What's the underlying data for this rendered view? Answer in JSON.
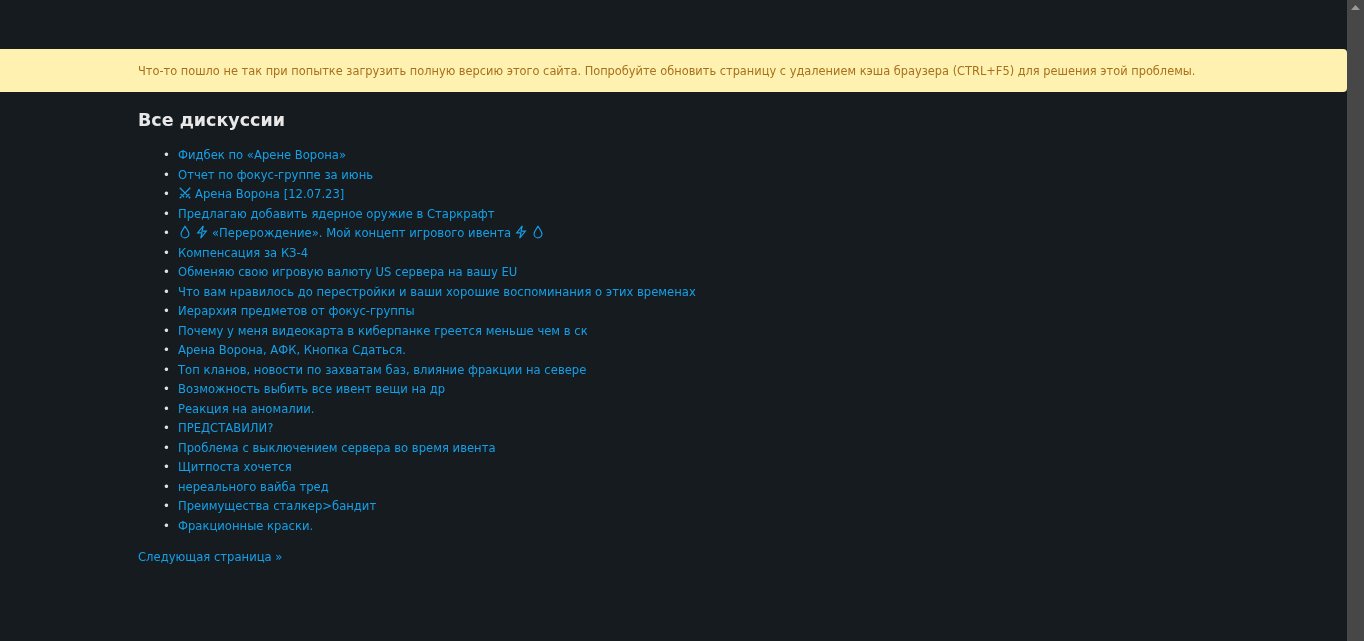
{
  "alert": {
    "text": "Что-то пошло не так при попытке загрузить полную версию этого сайта. Попробуйте обновить страницу с удалением кэша браузера (CTRL+F5) для решения этой проблемы."
  },
  "heading": "Все дискуссии",
  "discussions": [
    {
      "bullet": "•",
      "kind": "plain",
      "title": "Фидбек по «Арене Ворона»"
    },
    {
      "bullet": "•",
      "kind": "plain",
      "title": "Отчет по фокус-группе за июнь"
    },
    {
      "bullet": "•",
      "kind": "swords",
      "title": "Арена Ворона [12.07.23]"
    },
    {
      "bullet": "•",
      "kind": "plain",
      "title": "Предлагаю добавить ядерное оружие в Старкрафт"
    },
    {
      "bullet": "•",
      "kind": "drop-bolt",
      "title": "«Перерождение». Мой концепт игрового ивента"
    },
    {
      "bullet": "•",
      "kind": "plain",
      "title": "Компенсация за КЗ-4"
    },
    {
      "bullet": "•",
      "kind": "plain",
      "title": "Обменяю свою игровую валюту US сервера на вашу EU"
    },
    {
      "bullet": "•",
      "kind": "plain",
      "title": "Что вам нравилось до перестройки и ваши хорошие воспоминания о этих временах"
    },
    {
      "bullet": "•",
      "kind": "plain",
      "title": "Иерархия предметов от фокус-группы"
    },
    {
      "bullet": "•",
      "kind": "plain",
      "title": "Почему у меня видеокарта в киберпанке греется меньше чем в ск"
    },
    {
      "bullet": "•",
      "kind": "plain",
      "title": "Арена Ворона, АФК, Кнопка Сдаться."
    },
    {
      "bullet": "•",
      "kind": "plain",
      "title": "Топ кланов, новости по захватам баз, влияние фракции на севере"
    },
    {
      "bullet": "•",
      "kind": "plain",
      "title": "Возможность выбить все ивент вещи на др"
    },
    {
      "bullet": "•",
      "kind": "plain",
      "title": "Реакция на аномалии."
    },
    {
      "bullet": "•",
      "kind": "plain",
      "title": "ПРЕДСТАВИЛИ?"
    },
    {
      "bullet": "•",
      "kind": "plain",
      "title": "Проблема с выключением сервера во время ивента"
    },
    {
      "bullet": "•",
      "kind": "plain",
      "title": "Щитпоста хочется"
    },
    {
      "bullet": "•",
      "kind": "plain",
      "title": "нереального вайба тред"
    },
    {
      "bullet": "•",
      "kind": "plain",
      "title": "Преимущества сталкер>бандит"
    },
    {
      "bullet": "•",
      "kind": "plain",
      "title": "Фракционные краски."
    }
  ],
  "next_page": "Следующая страница »"
}
